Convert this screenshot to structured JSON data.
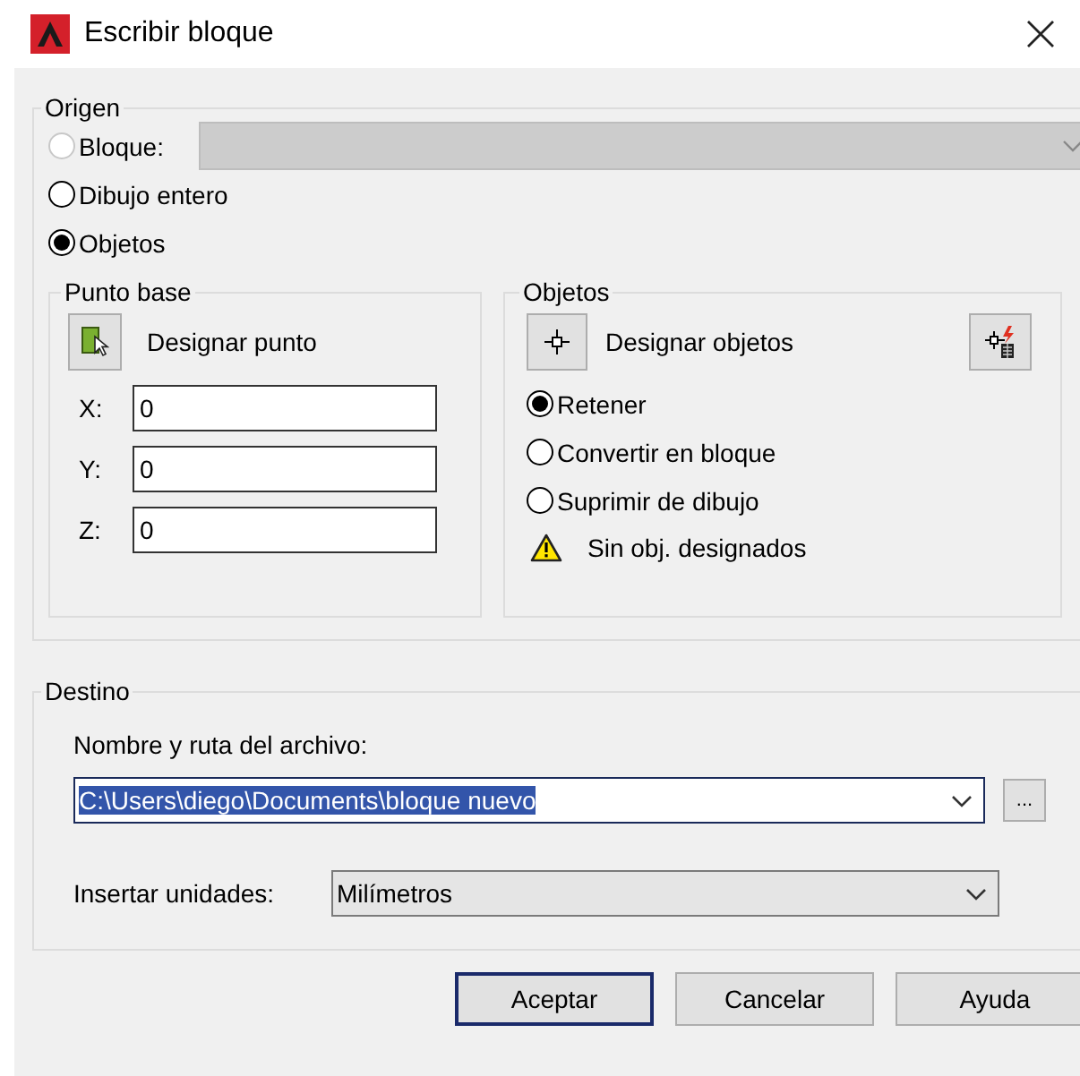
{
  "window": {
    "title": "Escribir bloque"
  },
  "origen": {
    "title": "Origen",
    "block_select": {
      "disabled": true
    },
    "options": [
      {
        "label": "Bloque:",
        "selected": false,
        "disabled": true
      },
      {
        "label": "Dibujo entero",
        "selected": false,
        "disabled": false
      },
      {
        "label": "Objetos",
        "selected": true,
        "disabled": false
      }
    ]
  },
  "punto_base": {
    "title": "Punto base",
    "pick_button": {
      "label": "Designar punto"
    },
    "coords": [
      {
        "label": "X:",
        "value": "0"
      },
      {
        "label": "Y:",
        "value": "0"
      },
      {
        "label": "Z:",
        "value": "0"
      }
    ]
  },
  "objetos": {
    "title": "Objetos",
    "select_button": {
      "label": "Designar objetos"
    },
    "options": [
      {
        "label": "Retener",
        "selected": true
      },
      {
        "label": "Convertir en bloque",
        "selected": false
      },
      {
        "label": "Suprimir de dibujo",
        "selected": false
      }
    ],
    "status": {
      "kind": "warning",
      "text": "Sin obj. designados"
    }
  },
  "destino": {
    "title": "Destino",
    "file_label": "Nombre y ruta del archivo:",
    "file_path": {
      "value": "C:\\Users\\diego\\Documents\\bloque nuevo",
      "highlighted": true
    },
    "browse": "...",
    "units_label": "Insertar unidades:",
    "units": {
      "value": "Milímetros"
    }
  },
  "buttons": [
    {
      "label": "Aceptar",
      "default": true
    },
    {
      "label": "Cancelar",
      "default": false
    },
    {
      "label": "Ayuda",
      "default": false
    }
  ]
}
